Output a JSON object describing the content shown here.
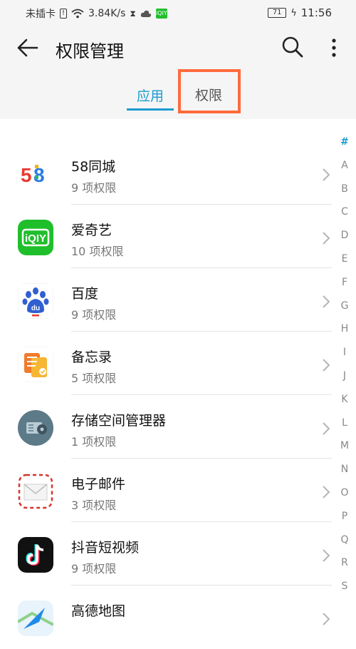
{
  "status_bar": {
    "carrier": "未插卡",
    "speed": "3.84K/s",
    "battery": "71",
    "time": "11:56"
  },
  "app_bar": {
    "title": "权限管理"
  },
  "tabs": [
    {
      "label": "应用",
      "active": true
    },
    {
      "label": "权限",
      "active": false,
      "highlighted": true
    }
  ],
  "apps": [
    {
      "name": "58同城",
      "permissions": "9 项权限",
      "icon": "58-tongcheng-icon"
    },
    {
      "name": "爱奇艺",
      "permissions": "10 项权限",
      "icon": "iqiyi-icon"
    },
    {
      "name": "百度",
      "permissions": "9 项权限",
      "icon": "baidu-icon"
    },
    {
      "name": "备忘录",
      "permissions": "5 项权限",
      "icon": "notes-icon"
    },
    {
      "name": "存储空间管理器",
      "permissions": "1 项权限",
      "icon": "storage-manager-icon"
    },
    {
      "name": "电子邮件",
      "permissions": "3 项权限",
      "icon": "email-icon"
    },
    {
      "name": "抖音短视频",
      "permissions": "9 项权限",
      "icon": "douyin-icon"
    },
    {
      "name": "高德地图",
      "permissions": "",
      "icon": "amap-icon"
    }
  ],
  "alphabet_index": [
    "#",
    "A",
    "B",
    "C",
    "D",
    "E",
    "F",
    "G",
    "H",
    "I",
    "J",
    "K",
    "L",
    "M",
    "N",
    "O",
    "P",
    "Q",
    "R",
    "S"
  ],
  "colors": {
    "accent": "#1a9bd0",
    "highlight_box": "#ff6a3d",
    "header_bg": "#f5f5f5"
  }
}
